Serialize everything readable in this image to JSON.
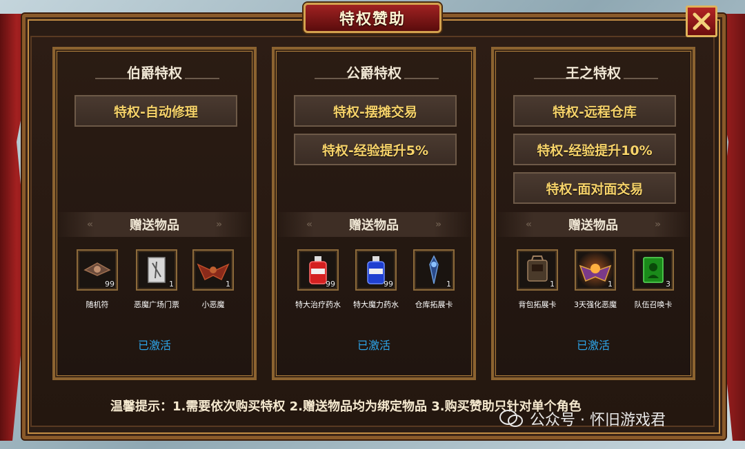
{
  "window": {
    "title": "特权赞助"
  },
  "close": {
    "icon": "close-icon"
  },
  "panels": [
    {
      "title": "伯爵特权",
      "privileges": [
        "特权-自动修理"
      ],
      "gift_label": "赠送物品",
      "items": [
        {
          "name": "随机符",
          "count": "99",
          "icon": "random-talisman-icon"
        },
        {
          "name": "恶魔广场门票",
          "count": "1",
          "icon": "devil-square-ticket-icon"
        },
        {
          "name": "小恶魔",
          "count": "1",
          "icon": "small-devil-icon"
        }
      ],
      "status": "已激活"
    },
    {
      "title": "公爵特权",
      "privileges": [
        "特权-摆摊交易",
        "特权-经验提升5%"
      ],
      "gift_label": "赠送物品",
      "items": [
        {
          "name": "特大治疗药水",
          "count": "99",
          "icon": "red-potion-icon"
        },
        {
          "name": "特大魔力药水",
          "count": "99",
          "icon": "blue-potion-icon"
        },
        {
          "name": "仓库拓展卡",
          "count": "1",
          "icon": "warehouse-expand-card-icon"
        }
      ],
      "status": "已激活"
    },
    {
      "title": "王之特权",
      "privileges": [
        "特权-远程仓库",
        "特权-经验提升10%",
        "特权-面对面交易"
      ],
      "gift_label": "赠送物品",
      "items": [
        {
          "name": "背包拓展卡",
          "count": "1",
          "icon": "backpack-expand-card-icon"
        },
        {
          "name": "3天强化恶魔",
          "count": "1",
          "icon": "enhanced-devil-icon"
        },
        {
          "name": "队伍召唤卡",
          "count": "3",
          "icon": "team-summon-card-icon"
        }
      ],
      "status": "已激活"
    }
  ],
  "tip": "温馨提示：1.需要依次购买特权 2.赠送物品均为绑定物品 3.购买赞助只针对单个角色",
  "watermark": "公众号 · 怀旧游戏君",
  "colors": {
    "privilege_text": "#f7d36a",
    "activated": "#2da4e8",
    "frame": "#8c6330"
  }
}
